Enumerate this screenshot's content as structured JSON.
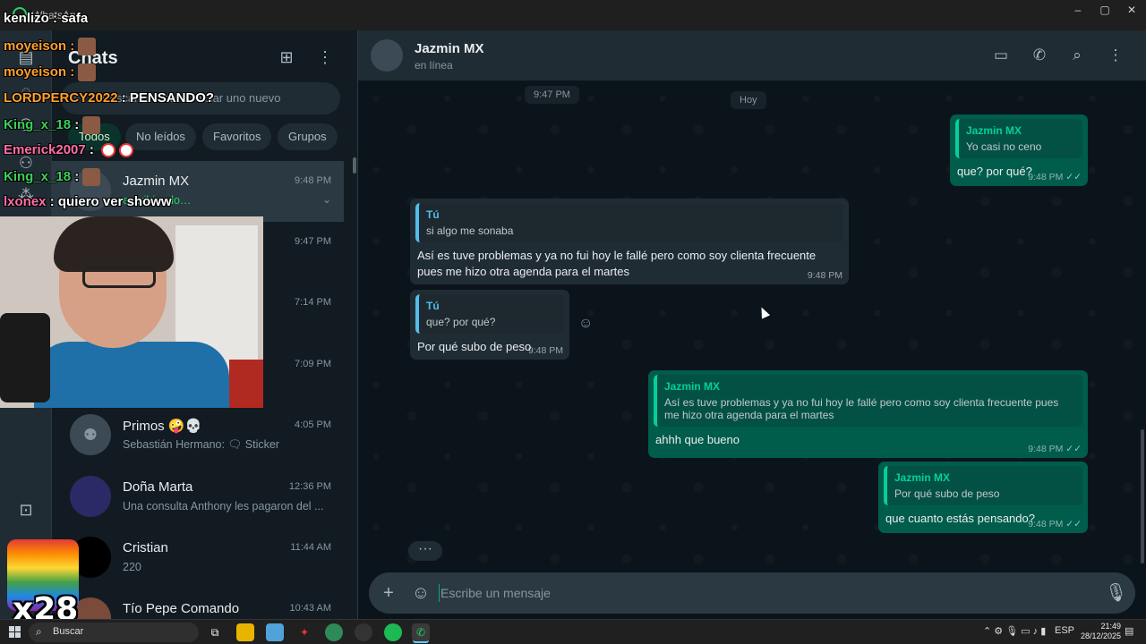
{
  "app": {
    "title": "WhatsApp"
  },
  "window_controls": {
    "minimize": "–",
    "maximize": "▢",
    "close": "✕"
  },
  "rail": {
    "icons": [
      "chats-icon",
      "status-icon",
      "channels-icon",
      "communities-icon",
      "meta-ai-icon"
    ]
  },
  "sidebar": {
    "title": "Chats",
    "search_placeholder": "Buscar un chat o iniciar uno nuevo",
    "search_visible_fragment": "iar uno nuevo",
    "filters": [
      "Todos",
      "No leídos",
      "Favoritos",
      "Grupos"
    ],
    "chats": [
      {
        "name": "Jazmin MX",
        "time": "9:48 PM",
        "subtitle": "escribiendo…",
        "typing": true,
        "selected": true
      },
      {
        "name": "",
        "time": "9:47 PM",
        "subtitle": ""
      },
      {
        "name": "",
        "time": "7:14 PM",
        "subtitle": ""
      },
      {
        "name": "",
        "time": "7:09 PM",
        "subtitle": ""
      },
      {
        "name": "Primos 🤪💀",
        "time": "4:05 PM",
        "subtitle": "Sebastián Hermano: 🗨 Sticker"
      },
      {
        "name": "Doña Marta",
        "time": "12:36 PM",
        "subtitle": "Una consulta Anthony les pagaron del ..."
      },
      {
        "name": "Cristian",
        "time": "11:44 AM",
        "subtitle": "220"
      },
      {
        "name": "Tío Pepe Comando",
        "time": "10:43 AM",
        "subtitle": ""
      }
    ]
  },
  "chat": {
    "contact_name": "Jazmin MX",
    "contact_status": "en línea",
    "day_label_prev_time": "9:47 PM",
    "day_label": "Hoy",
    "messages": [
      {
        "dir": "out",
        "quote_author": "Jazmin MX",
        "quote_text": "Yo casi no ceno",
        "text": "que? por qué?",
        "time": "9:48 PM",
        "tick": "✓✓"
      },
      {
        "dir": "in",
        "quote_author": "Tú",
        "quote_text": "si algo me sonaba",
        "text": "Así es tuve problemas y ya no fui hoy le fallé pero como soy clienta frecuente pues me hizo otra agenda para el martes",
        "time": "9:48 PM"
      },
      {
        "dir": "in",
        "quote_author": "Tú",
        "quote_text": "que? por qué?",
        "text": "Por qué subo de peso",
        "time": "9:48 PM"
      },
      {
        "dir": "out",
        "quote_author": "Jazmin MX",
        "quote_text": "Así es tuve problemas y ya no fui hoy le fallé pero como soy clienta frecuente pues me hizo otra agenda para el martes",
        "text": "ahhh que bueno",
        "time": "9:48 PM",
        "tick": "✓✓"
      },
      {
        "dir": "out",
        "quote_author": "Jazmin MX",
        "quote_text": "Por qué subo de peso",
        "text": "que cuanto estás pensando?",
        "time": "9:48 PM",
        "tick": "✓✓"
      }
    ],
    "composer_placeholder": "Escribe un mensaje"
  },
  "stream_overlay": {
    "lines": [
      {
        "user": "kenlizo",
        "color": "#ffffff",
        "text": "safa"
      },
      {
        "user": "moyeison",
        "color": "#ff9f2e",
        "text": "",
        "emote": true
      },
      {
        "user": "moyeison",
        "color": "#ff9f2e",
        "text": "",
        "emote": true
      },
      {
        "user": "LORDPERCY2022",
        "color": "#ff9f2e",
        "text": "PENSANDO?"
      },
      {
        "user": "King_x_18",
        "color": "#3ccf5b",
        "text": "",
        "emote": true
      },
      {
        "user": "Emerick2007",
        "color": "#ff6fa8",
        "text": "",
        "noemote": true
      },
      {
        "user": "King_x_18",
        "color": "#3ccf5b",
        "text": "",
        "emote": true
      },
      {
        "user": "lxonex",
        "color": "#ff6fa8",
        "text": "quiero ver showw"
      }
    ],
    "badge": "x28"
  },
  "taskbar": {
    "search_label": "Buscar",
    "apps": [
      "task-view-icon",
      "file-explorer-icon",
      "notes-icon",
      "app-icon",
      "chrome-icon",
      "obs-icon",
      "spotify-icon",
      "whatsapp-icon"
    ],
    "lang": "ESP",
    "time": "21:49",
    "date": "28/12/2025"
  }
}
